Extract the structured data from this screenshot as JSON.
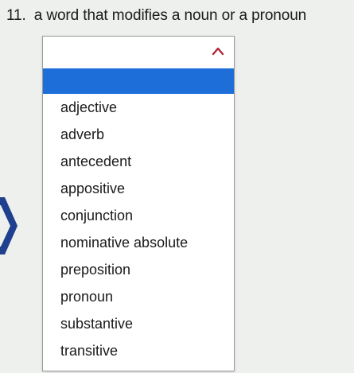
{
  "question": {
    "number": "11.",
    "text": "a word that modifies a noun or a pronoun"
  },
  "dropdown": {
    "selected_value": "",
    "options": [
      "adjective",
      "adverb",
      "antecedent",
      "appositive",
      "conjunction",
      "nominative absolute",
      "preposition",
      "pronoun",
      "substantive",
      "transitive"
    ]
  },
  "colors": {
    "highlight": "#1d6ed8",
    "chevron": "#b3273a",
    "left_arrow": "#1f3f8f"
  },
  "icons": {
    "chevron": "chevron-up-icon",
    "left_arrow": "arrow-right-icon"
  }
}
